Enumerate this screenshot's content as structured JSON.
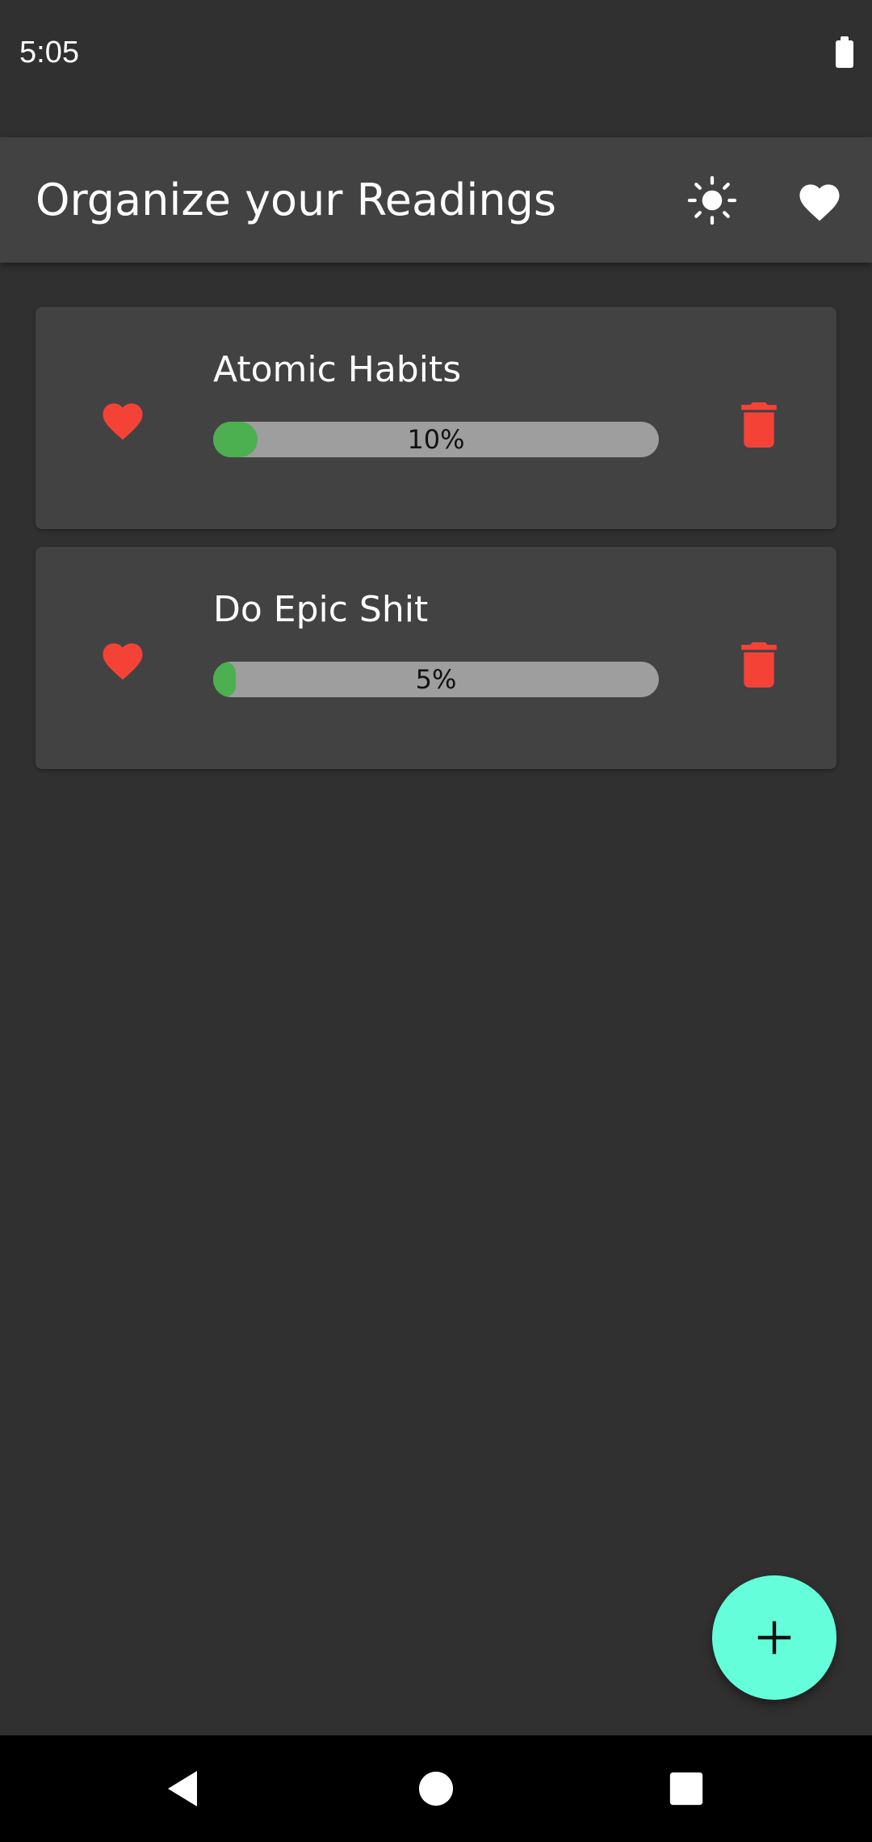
{
  "status_bar": {
    "time": "5:05",
    "battery_icon": "battery-full-icon"
  },
  "app_bar": {
    "title": "Organize your Readings",
    "theme_icon": "brightness-icon",
    "favorites_icon": "heart-icon"
  },
  "books": [
    {
      "title": "Atomic Habits",
      "progress": 10,
      "progress_label": "10%",
      "favorite": true
    },
    {
      "title": "Do Epic Shit",
      "progress": 5,
      "progress_label": "5%",
      "favorite": true
    }
  ],
  "fab": {
    "icon": "plus-icon"
  },
  "nav_bar": {
    "back_icon": "back-icon",
    "home_icon": "home-icon",
    "recents_icon": "recents-icon"
  },
  "colors": {
    "background": "#303030",
    "surface": "#424242",
    "accent": "#64ffda",
    "progress_fill": "#4caf50",
    "progress_track": "#9e9e9e",
    "heart_red": "#f44336"
  }
}
